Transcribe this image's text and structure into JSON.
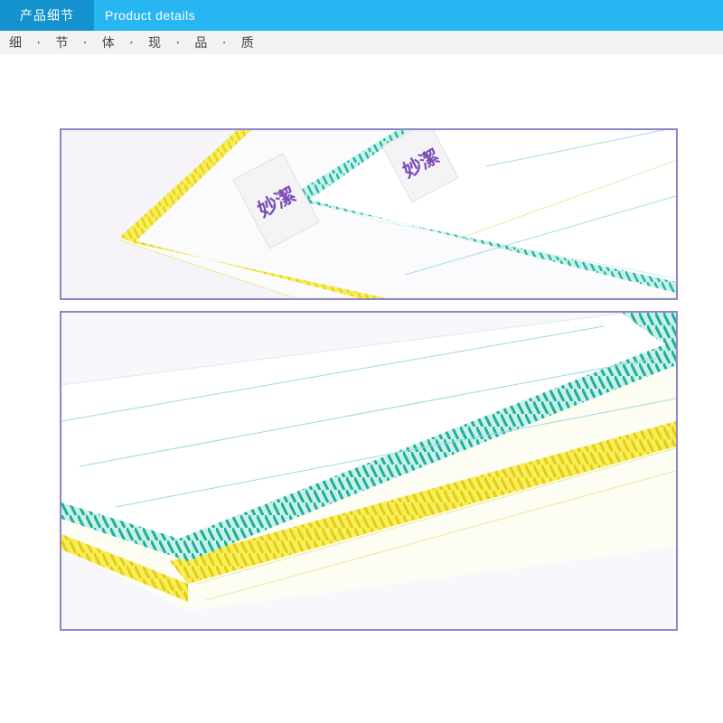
{
  "header": {
    "section_label": "产品细节",
    "title_en": "Product details"
  },
  "subheader": {
    "text": "细 · 节 · 体 · 现 · 品 · 质"
  },
  "photos": [
    {
      "name": "detail-photo-top",
      "brand_tags": [
        "妙潔",
        "妙潔"
      ]
    },
    {
      "name": "detail-photo-bottom"
    }
  ],
  "colors": {
    "header_bg": "#28b6f3",
    "header_label_bg": "#1392ce",
    "subheader_bg": "#f2f2f2",
    "frame_border": "#8f86c8",
    "stitch_yellow": "#f5e63a",
    "stitch_teal": "#27b9a6",
    "brand_text": "#7a4bb5"
  }
}
